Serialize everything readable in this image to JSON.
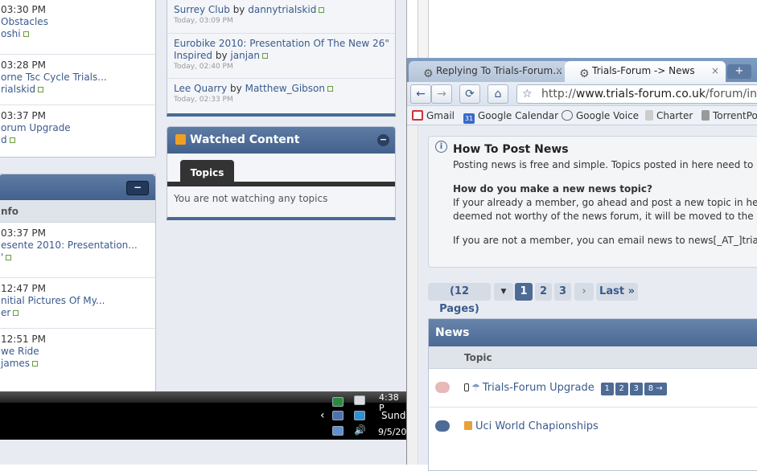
{
  "left_panel": {
    "recent_rows": [
      {
        "time": "03:30 PM",
        "title": "Obstacles",
        "user": "oshi"
      },
      {
        "time": "03:28 PM",
        "title": "orne Tsc Cycle Trials...",
        "user": "rialskid"
      },
      {
        "time": "03:37 PM",
        "title": "orum Upgrade",
        "user": "d"
      }
    ],
    "collapse_label": "−",
    "subheader": "nfo",
    "info_rows": [
      {
        "time": "03:37 PM",
        "title": "esente 2010: Presentation...",
        "user": "'"
      },
      {
        "time": "12:47 PM",
        "title": "nitial Pictures Of My...",
        "user": "er"
      },
      {
        "time": "12:51 PM",
        "title": "we Ride",
        "user": "james"
      }
    ]
  },
  "middle_panel": {
    "news_rows": [
      {
        "title": "Surrey Club",
        "by": "by",
        "user": "dannytrialskid",
        "date": "Today, 03:09 PM"
      },
      {
        "title": "Eurobike 2010: Presentation Of The New 26\" Inspired",
        "by": "by",
        "user": "janjan",
        "date": "Today, 02:40 PM"
      },
      {
        "title": "Lee Quarry",
        "by": "by",
        "user": "Matthew_Gibson",
        "date": "Today, 02:33 PM"
      }
    ],
    "watched": {
      "title": "Watched Content",
      "collapse_label": "−",
      "tab": "Topics",
      "empty_text": "You are not watching any topics"
    }
  },
  "taskbar": {
    "time": "4:38 P",
    "day": "Sunda",
    "date": "9/5/20",
    "expand": "‹"
  },
  "browser": {
    "tabs": [
      {
        "label": "Replying To Trials-Forum...",
        "active": false
      },
      {
        "label": "Trials-Forum -> News",
        "active": true
      }
    ],
    "new_tab": "+",
    "close": "×",
    "url_prefix": "http://",
    "url_host": "www.trials-forum.co.uk",
    "url_path": "/forum/inde",
    "bookmarks": [
      "Gmail",
      "Google Calendar",
      "Google Voice",
      "Charter",
      "TorrentPo"
    ],
    "calendar_badge": "31"
  },
  "page": {
    "howto_title": "How To Post News",
    "howto_line1": "Posting news is free and simple. Topics posted in here need to be",
    "howto_q": "How do you make a new news topic?",
    "howto_line2": "If your already a member, go ahead and post a new topic in here.",
    "howto_line3": "deemed not worthy of the news forum, it will be moved to the app",
    "howto_line4": "If you are not a member, you can email news to news[_AT_]trials",
    "pages_label": "(12 Pages)",
    "page_numbers": [
      "1",
      "2",
      "3"
    ],
    "next_label": "›",
    "last_label": "Last »",
    "news_header": "News",
    "topic_header": "Topic",
    "topics": [
      {
        "title": "Trials-Forum Upgrade",
        "pages": [
          "1",
          "2",
          "3",
          "8 →"
        ]
      },
      {
        "title": "Uci World Chapionships",
        "pages": []
      }
    ]
  }
}
